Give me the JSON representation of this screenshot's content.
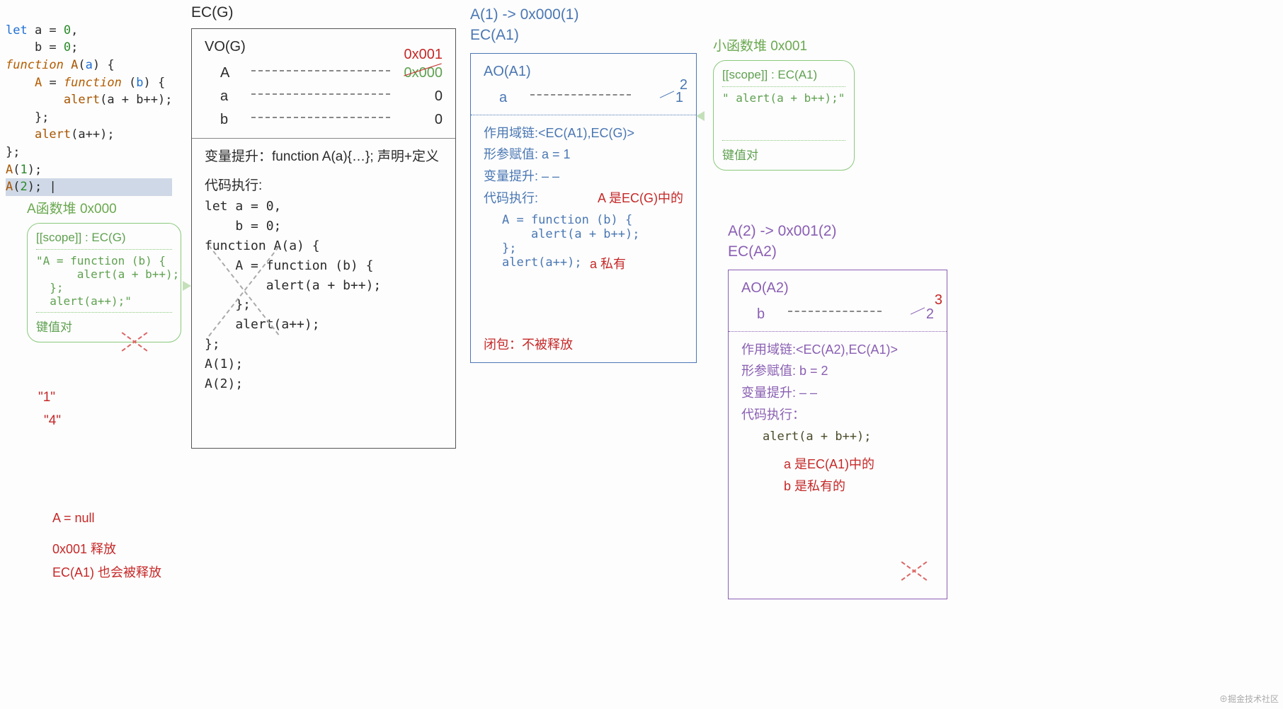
{
  "code_lines": [
    "let a = 0,",
    "    b = 0;",
    "function A(a) {",
    "    A = function (b) {",
    "        alert(a + b++);",
    "    };",
    "    alert(a++);",
    "};",
    "A(1);",
    "A(2); |"
  ],
  "a_stack": {
    "title": "A函数堆   0x000",
    "scope": "[[scope]] : EC(G)",
    "body": "\"A = function (b) {\n      alert(a + b++);\n  };\n  alert(a++);\"",
    "label": "键值对"
  },
  "outputs": {
    "o1": "\"1\"",
    "o2": "\"4\""
  },
  "release": {
    "l1": "A = null",
    "l2": "0x001 释放",
    "l3": "EC(A1) 也会被释放"
  },
  "ecg": {
    "title": "EC(G)",
    "vo_label": "VO(G)",
    "addr_new": "0x001",
    "addr_old": "0x000",
    "row_A": "A",
    "row_a": "a",
    "row_a_v": "0",
    "row_b": "b",
    "row_b_v": "0",
    "hoist": "变量提升：function A(a){…};  声明+定义",
    "exec_label": "代码执行:",
    "exec_body": "let a = 0,\n    b = 0;\nfunction A(a) {\n    A = function (b) {\n        alert(a + b++);\n    };\n    alert(a++);\n};\nA(1);\nA(2);"
  },
  "eca1": {
    "title1": "A(1) -> 0x000(1)",
    "title2": "EC(A1)",
    "ao": "AO(A1)",
    "row_a": "a",
    "row_old": "1",
    "row_new": "2",
    "line1": "作用域链:<EC(A1),EC(G)>",
    "line2": "形参赋值: a = 1",
    "line3": "变量提升: – –",
    "line4": "代码执行:",
    "note1": "A 是EC(G)中的",
    "code": "A = function (b) {\n    alert(a + b++);\n};\nalert(a++);",
    "note2": "a 私有",
    "closure": "闭包：不被释放"
  },
  "small_stack": {
    "title": "小函数堆   0x001",
    "scope": "[[scope]] : EC(A1)",
    "body": "\" alert(a + b++);\"",
    "label": "键值对"
  },
  "eca2": {
    "title1": "A(2) -> 0x001(2)",
    "title2": "EC(A2)",
    "ao": "AO(A2)",
    "row_b": "b",
    "row_old": "2",
    "row_new": "3",
    "line1": "作用域链:<EC(A2),EC(A1)>",
    "line2": "形参赋值: b = 2",
    "line3": "变量提升: – –",
    "line4": "代码执行：",
    "code": "alert(a + b++);",
    "note1": "a  是EC(A1)中的",
    "note2": "b  是私有的"
  },
  "watermark": "⊕掘金技术社区"
}
